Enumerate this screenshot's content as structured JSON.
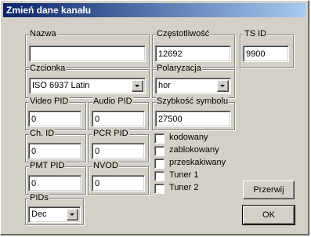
{
  "window": {
    "title": "Zmień dane kanału"
  },
  "fields": {
    "nazwa": {
      "label": "Nazwa",
      "value": ""
    },
    "czestotliwosc": {
      "label": "Częstotliwość",
      "value": "12692"
    },
    "tsid": {
      "label": "TS ID",
      "value": "9900"
    },
    "czcionka": {
      "label": "Czcionka",
      "value": "ISO 6937 Latin"
    },
    "polaryzacja": {
      "label": "Polaryzacja",
      "value": "hor"
    },
    "video_pid": {
      "label": "Video PID",
      "value": "0"
    },
    "audio_pid": {
      "label": "Audio PID",
      "value": "0"
    },
    "szybkosc": {
      "label": "Szybkość symbolu",
      "value": "27500"
    },
    "ch_id": {
      "label": "Ch. ID",
      "value": "0"
    },
    "pcr_pid": {
      "label": "PCR PID",
      "value": "0"
    },
    "pmt_pid": {
      "label": "PMT PID",
      "value": "0"
    },
    "nvod": {
      "label": "NVOD",
      "value": "0"
    },
    "pids": {
      "label": "PIDs",
      "value": "Dec"
    }
  },
  "checkboxes": [
    {
      "label": "kodowany",
      "checked": false
    },
    {
      "label": "zablokowany",
      "checked": false
    },
    {
      "label": "przeskakiwany",
      "checked": false
    },
    {
      "label": "Tuner 1",
      "checked": false
    },
    {
      "label": "Tuner 2",
      "checked": false
    }
  ],
  "buttons": {
    "cancel": "Przerwij",
    "ok": "OK"
  }
}
